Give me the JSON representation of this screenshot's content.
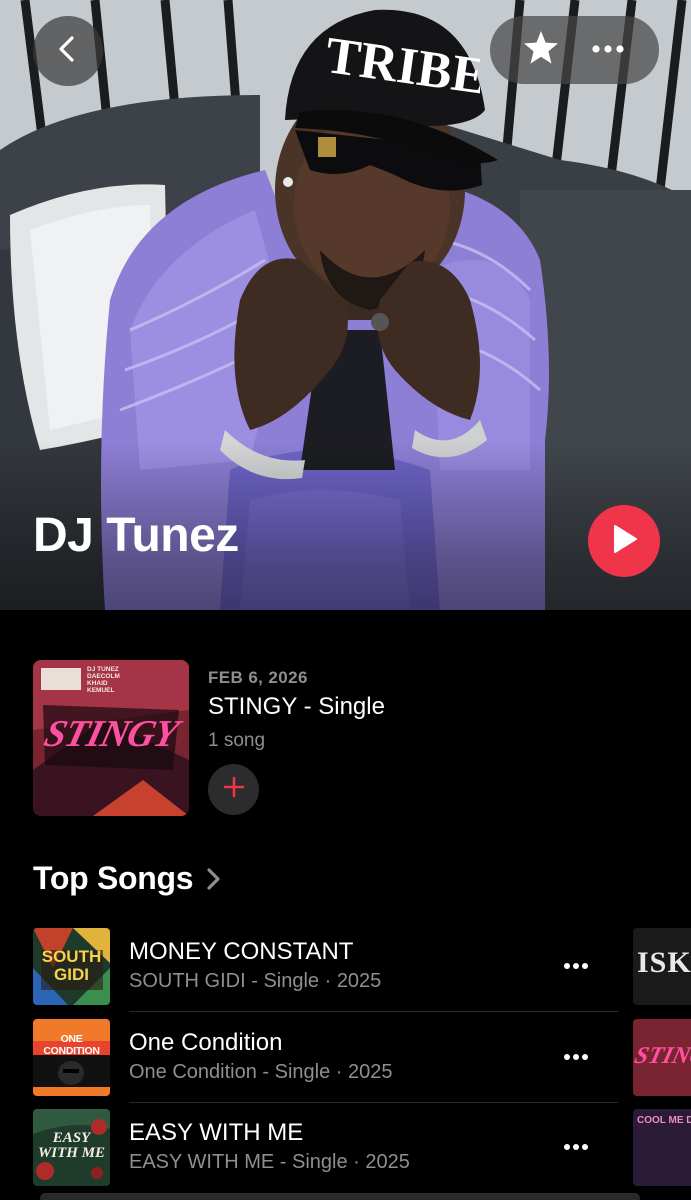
{
  "artist": {
    "name": "DJ Tunez",
    "cap_text": "TRIBE"
  },
  "nav": {
    "back_icon": "chevron-left-icon",
    "favorite_icon": "star-icon",
    "more_icon": "ellipsis-icon",
    "play_icon": "play-icon"
  },
  "latest_release": {
    "date": "FEB 6, 2026",
    "title": "STINGY - Single",
    "count": "1 song",
    "add_icon": "plus-icon",
    "artwork_credits": [
      "DJ TUNEZ",
      "DAECOLM",
      "KHAID",
      "KEMUEL"
    ],
    "artwork_text": "STINGY"
  },
  "top_songs": {
    "heading": "Top Songs",
    "items": [
      {
        "title": "MONEY CONSTANT",
        "subtitle": "SOUTH GIDI - Single · 2025",
        "art_text": "SOUTH GIDI"
      },
      {
        "title": "One Condition",
        "subtitle": "One Condition - Single · 2025",
        "art_text": "ONE CONDITION"
      },
      {
        "title": "EASY WITH ME",
        "subtitle": "EASY WITH ME - Single · 2025",
        "art_text": "EASY WITH ME"
      }
    ],
    "peek_texts": [
      "ISKAB",
      "STINGY",
      "COOL ME DO"
    ]
  },
  "colors": {
    "accent": "#f0354b",
    "secondary_text": "#8e8e93",
    "background": "#000000"
  }
}
